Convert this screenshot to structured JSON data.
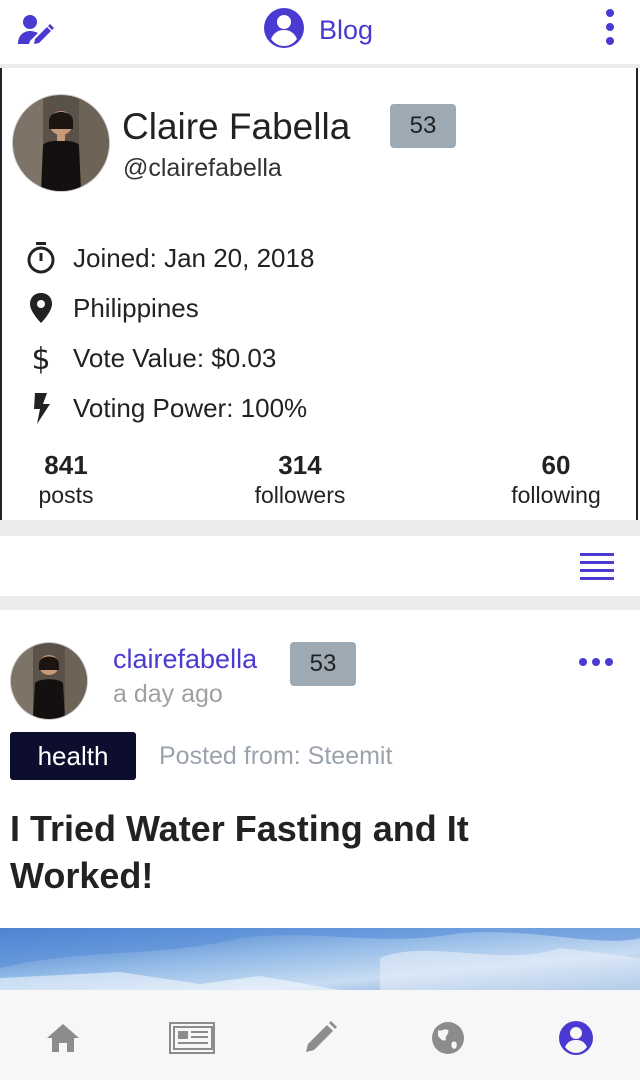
{
  "topbar": {
    "left_icon": "edit-profile-icon",
    "center_icon": "account-circle-icon",
    "title": "Blog",
    "right_icon": "more-vertical-icon"
  },
  "profile": {
    "name": "Claire Fabella",
    "reputation": "53",
    "handle": "@clairefabella",
    "info": [
      {
        "icon": "timer-icon",
        "text": "Joined: Jan 20, 2018"
      },
      {
        "icon": "location-pin-icon",
        "text": "Philippines"
      },
      {
        "icon": "dollar-icon",
        "text": "Vote Value: $0.03"
      },
      {
        "icon": "lightning-icon",
        "text": "Voting Power: 100%"
      }
    ],
    "stats": [
      {
        "value": "841",
        "label": "posts"
      },
      {
        "value": "314",
        "label": "followers"
      },
      {
        "value": "60",
        "label": "following"
      }
    ]
  },
  "menu_icon": "list-menu-icon",
  "post": {
    "author": "clairefabella",
    "reputation": "53",
    "time": "a day ago",
    "tag": "health",
    "posted_from": "Posted from: Steemit",
    "title": "I Tried Water Fasting and It Worked!"
  },
  "bottom_nav": [
    {
      "icon": "home-icon",
      "active": false
    },
    {
      "icon": "newspaper-icon",
      "active": false
    },
    {
      "icon": "pencil-icon",
      "active": false
    },
    {
      "icon": "globe-icon",
      "active": false
    },
    {
      "icon": "account-circle-icon",
      "active": true
    }
  ],
  "colors": {
    "accent": "#4a3ad1",
    "badge": "#9daab4",
    "tag_bg": "#0d0d2e",
    "muted_text": "#9aa3ad",
    "nav_inactive": "#8c8c8c"
  }
}
